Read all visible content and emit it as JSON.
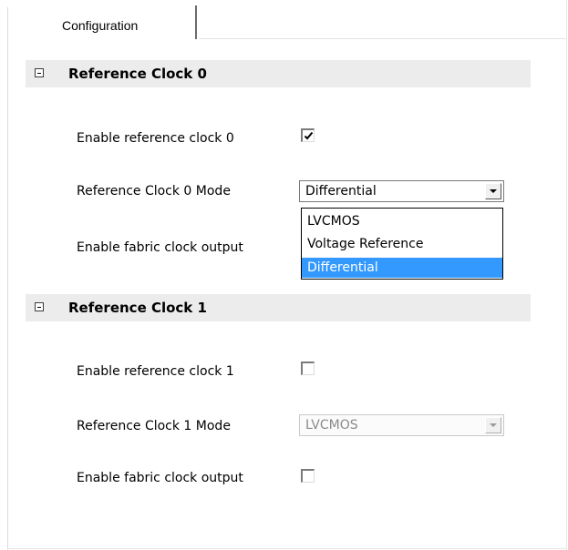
{
  "tab": {
    "label": "Configuration"
  },
  "sections": [
    {
      "title": "Reference Clock 0",
      "enable_label": "Enable reference clock 0",
      "enable_checked": true,
      "mode_label": "Reference Clock 0 Mode",
      "mode_value": "Differential",
      "fabric_label": "Enable fabric clock output",
      "dropdown_open": true,
      "options": [
        "LVCMOS",
        "Voltage Reference",
        "Differential"
      ],
      "highlighted_option": "Differential"
    },
    {
      "title": "Reference Clock 1",
      "enable_label": "Enable reference clock 1",
      "enable_checked": false,
      "mode_label": "Reference Clock 1 Mode",
      "mode_value": "LVCMOS",
      "mode_enabled": false,
      "fabric_label": "Enable fabric clock output",
      "fabric_checked": false
    }
  ],
  "colors": {
    "section_header_bg": "#ececec",
    "selection_bg": "#3399ff",
    "disabled_text": "#8a8a8a"
  }
}
